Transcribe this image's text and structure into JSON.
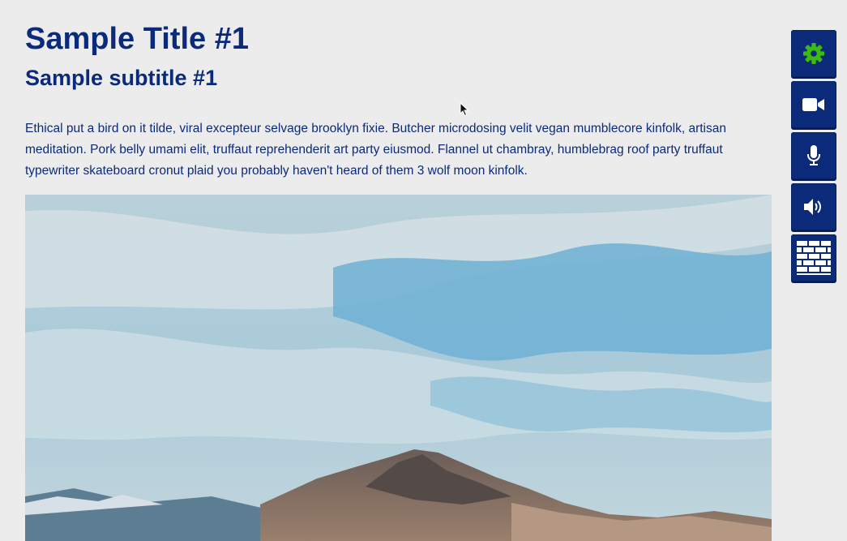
{
  "page": {
    "title": "Sample Title #1",
    "subtitle": "Sample subtitle #1",
    "body": "Ethical put a bird on it tilde, viral excepteur selvage brooklyn fixie. Butcher microdosing velit vegan mumblecore kinfolk, artisan meditation. Pork belly umami elit, truffaut reprehenderit art party eiusmod. Flannel ut chambray, humblebrag roof party truffaut typewriter skateboard cronut plaid you probably haven't heard of them 3 wolf moon kinfolk."
  },
  "toolbar": {
    "buttons": [
      {
        "icon": "gear-icon",
        "color": "#3dbb10"
      },
      {
        "icon": "video-camera-icon",
        "color": "#ffffff"
      },
      {
        "icon": "microphone-icon",
        "color": "#ffffff"
      },
      {
        "icon": "speaker-icon",
        "color": "#ffffff"
      },
      {
        "icon": "brick-wall-icon",
        "color": "#ffffff"
      }
    ]
  },
  "colors": {
    "text": "#0b2a7a",
    "background": "#ececec",
    "toolbar_button": "#0b2a7a",
    "gear_accent": "#3dbb10"
  }
}
